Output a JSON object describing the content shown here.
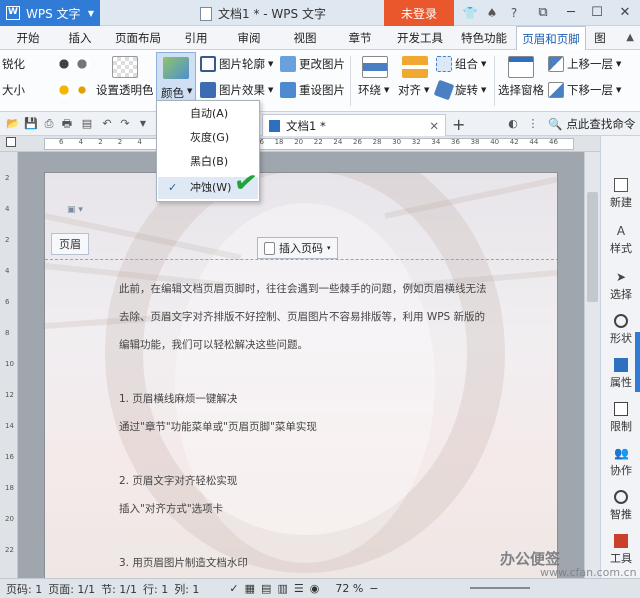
{
  "app": {
    "name": "WPS 文字",
    "title": "文档1 * - WPS 文字",
    "login_label": "未登录"
  },
  "menu": [
    "开始",
    "插入",
    "页面布局",
    "引用",
    "审阅",
    "视图",
    "章节",
    "开发工具",
    "特色功能",
    "页眉和页脚",
    "图"
  ],
  "ribbon": {
    "sharpen": "锐化",
    "size": "大小",
    "set_transparent": "设置透明色",
    "color": "颜色",
    "picture_outline": "图片轮廓",
    "picture_effect": "图片效果",
    "change_picture": "更改图片",
    "reset_picture": "重设图片",
    "wrap": "环绕",
    "align": "对齐",
    "group": "组合",
    "rotate": "旋转",
    "selection_pane": "选择窗格",
    "bring_forward": "上移一层",
    "send_backward": "下移一层"
  },
  "color_menu": {
    "items": [
      "自动(A)",
      "灰度(G)",
      "黑白(B)",
      "冲蚀(W)"
    ],
    "selected": "冲蚀(W)"
  },
  "tabs": {
    "doc_tab": "文档1 *",
    "search_cmd": "点此查找命令"
  },
  "ruler": {
    "numbers": [
      "6",
      "4",
      "2",
      "2",
      "4",
      "6",
      "8",
      "10",
      "12",
      "14",
      "16",
      "18",
      "20",
      "22",
      "24",
      "26",
      "28",
      "30",
      "32",
      "34",
      "36",
      "38",
      "40",
      "42",
      "44",
      "46"
    ],
    "vnumbers": [
      "2",
      "4",
      "2",
      "4",
      "6",
      "8",
      "10",
      "12",
      "14",
      "16",
      "18",
      "20",
      "22"
    ]
  },
  "page": {
    "header_label": "页眉",
    "insert_page_number": "插入页码",
    "lines": [
      "此前，在编辑文档页眉页脚时，往往会遇到一些棘手的问题，例如页眉横线无法",
      "去除、页眉文字对齐排版不好控制、页眉图片不容易排版等，利用 WPS 新版的",
      "编辑功能，我们可以轻松解决这些问题。",
      "1. 页眉横线麻烦一键解决",
      "通过\"章节\"功能菜单或\"页眉页脚\"菜单实现",
      "2. 页眉文字对齐轻松实现",
      "插入\"对齐方式\"选项卡",
      "3. 用页眉图片制造文档水印"
    ]
  },
  "sidebar": [
    "新建",
    "样式",
    "选择",
    "形状",
    "属性",
    "限制",
    "协作",
    "智推",
    "工具"
  ],
  "status": {
    "page_num": "页码: 1",
    "pages": "页面: 1/1",
    "section": "节: 1/1",
    "row": "行: 1",
    "col": "列: 1",
    "zoom": "72 %"
  },
  "watermark": {
    "text": "办公便签",
    "sub": "www.cfan.com.cn"
  }
}
